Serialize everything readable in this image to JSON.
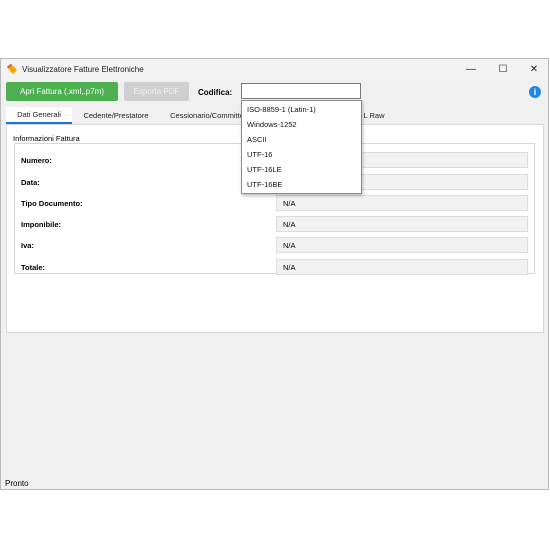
{
  "window": {
    "title": "Visualizzatore Fatture Elettroniche",
    "controls": {
      "minimize": "—",
      "maximize": "☐",
      "close": "✕"
    }
  },
  "toolbar": {
    "open_label": "Apri Fattura (.xml,.p7m)",
    "pdf_label": "Esporta PDF",
    "encoding_label": "Codifica:",
    "encoding_value": "",
    "info_icon": "i"
  },
  "tabs": [
    {
      "label": "Dati Generali"
    },
    {
      "label": "Cedente/Prestatore"
    },
    {
      "label": "Cessionario/Committe"
    },
    {
      "label": "L Raw"
    }
  ],
  "section": {
    "title": "Informazioni Fattura",
    "rows": [
      {
        "label": "Numero:",
        "value": ""
      },
      {
        "label": "Data:",
        "value": ""
      },
      {
        "label": "Tipo Documento:",
        "value": "N/A"
      },
      {
        "label": "Imponibile:",
        "value": "N/A"
      },
      {
        "label": "Iva:",
        "value": "N/A"
      },
      {
        "label": "Totale:",
        "value": "N/A"
      }
    ]
  },
  "dropdown": {
    "options": [
      "ISO-8859-1 (Latin-1)",
      "Windows-1252",
      "ASCII",
      "UTF-16",
      "UTF-16LE",
      "UTF-16BE"
    ]
  },
  "status_bar": {
    "text": "Pronto"
  },
  "colors": {
    "accent_green": "#4caf50",
    "info_blue": "#1e88e5",
    "tab_underline": "#1976d2"
  }
}
